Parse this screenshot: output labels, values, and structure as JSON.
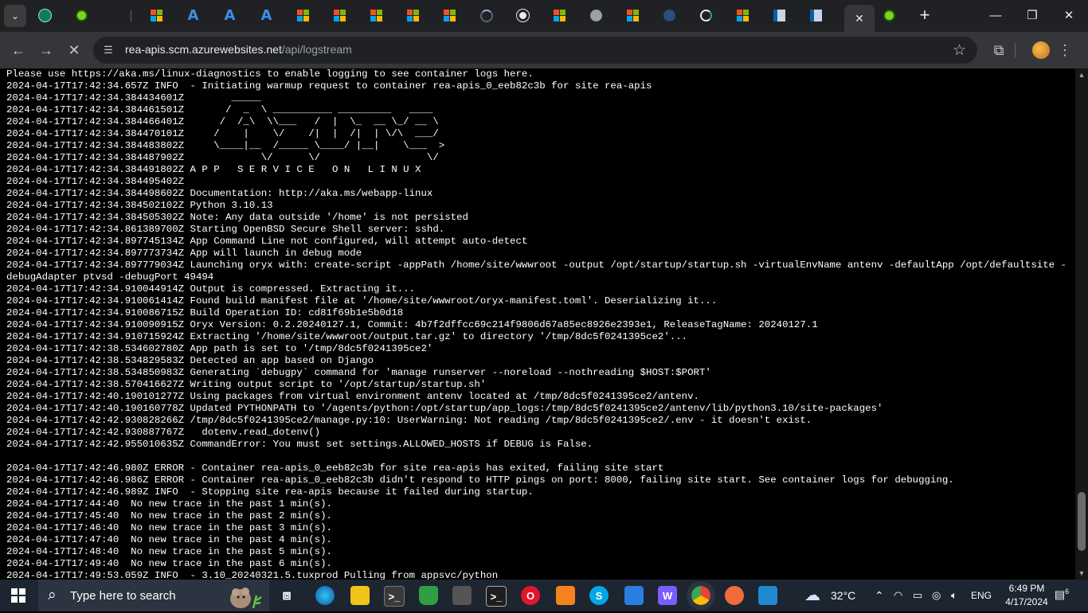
{
  "browser": {
    "tab_list_icon": "chevron-down-icon",
    "active_tab_close": "✕",
    "new_tab": "+",
    "window_controls": {
      "minimize": "—",
      "restore": "❐",
      "close": "✕"
    },
    "address": {
      "host": "rea-apis.scm.azurewebsites.net",
      "path": "/api/logstream"
    }
  },
  "log_lines": [
    "Please use https://aka.ms/linux-diagnostics to enable logging to see container logs here.",
    "2024-04-17T17:42:34.657Z INFO  - Initiating warmup request to container rea-apis_0_eeb82c3b for site rea-apis",
    "2024-04-17T17:42:34.384434601Z        _____",
    "2024-04-17T17:42:34.384461501Z       /  _  \\ __________ _________   ____",
    "2024-04-17T17:42:34.384466401Z      /  /_\\  \\\\___   /  |  \\_  __ \\_/ __ \\",
    "2024-04-17T17:42:34.384470101Z     /    |    \\/    /|  |  /|  | \\/\\  ___/",
    "2024-04-17T17:42:34.384483802Z     \\____|__  /_____ \\____/ |__|    \\___  >",
    "2024-04-17T17:42:34.384487902Z             \\/      \\/                  \\/",
    "2024-04-17T17:42:34.384491802Z A P P   S E R V I C E   O N   L I N U X",
    "2024-04-17T17:42:34.384495402Z",
    "2024-04-17T17:42:34.384498602Z Documentation: http://aka.ms/webapp-linux",
    "2024-04-17T17:42:34.384502102Z Python 3.10.13",
    "2024-04-17T17:42:34.384505302Z Note: Any data outside '/home' is not persisted",
    "2024-04-17T17:42:34.861389700Z Starting OpenBSD Secure Shell server: sshd.",
    "2024-04-17T17:42:34.897745134Z App Command Line not configured, will attempt auto-detect",
    "2024-04-17T17:42:34.897773734Z App will launch in debug mode",
    "2024-04-17T17:42:34.897779034Z Launching oryx with: create-script -appPath /home/site/wwwroot -output /opt/startup/startup.sh -virtualEnvName antenv -defaultApp /opt/defaultsite -",
    "debugAdapter ptvsd -debugPort 49494",
    "2024-04-17T17:42:34.910044914Z Output is compressed. Extracting it...",
    "2024-04-17T17:42:34.910061414Z Found build manifest file at '/home/site/wwwroot/oryx-manifest.toml'. Deserializing it...",
    "2024-04-17T17:42:34.910086715Z Build Operation ID: cd81f69b1e5b0d18",
    "2024-04-17T17:42:34.910090915Z Oryx Version: 0.2.20240127.1, Commit: 4b7f2dffcc69c214f9806d67a85ec8926e2393e1, ReleaseTagName: 20240127.1",
    "2024-04-17T17:42:34.910715924Z Extracting '/home/site/wwwroot/output.tar.gz' to directory '/tmp/8dc5f0241395ce2'...",
    "2024-04-17T17:42:38.534602780Z App path is set to '/tmp/8dc5f0241395ce2'",
    "2024-04-17T17:42:38.534829583Z Detected an app based on Django",
    "2024-04-17T17:42:38.534850983Z Generating `debugpy` command for 'manage runserver --noreload --nothreading $HOST:$PORT'",
    "2024-04-17T17:42:38.570416627Z Writing output script to '/opt/startup/startup.sh'",
    "2024-04-17T17:42:40.190101277Z Using packages from virtual environment antenv located at /tmp/8dc5f0241395ce2/antenv.",
    "2024-04-17T17:42:40.190160778Z Updated PYTHONPATH to '/agents/python:/opt/startup/app_logs:/tmp/8dc5f0241395ce2/antenv/lib/python3.10/site-packages'",
    "2024-04-17T17:42:42.930828266Z /tmp/8dc5f0241395ce2/manage.py:10: UserWarning: Not reading /tmp/8dc5f0241395ce2/.env - it doesn't exist.",
    "2024-04-17T17:42:42.930887767Z   dotenv.read_dotenv()",
    "2024-04-17T17:42:42.955010635Z CommandError: You must set settings.ALLOWED_HOSTS if DEBUG is False.",
    "",
    "2024-04-17T17:42:46.980Z ERROR - Container rea-apis_0_eeb82c3b for site rea-apis has exited, failing site start",
    "2024-04-17T17:42:46.986Z ERROR - Container rea-apis_0_eeb82c3b didn't respond to HTTP pings on port: 8000, failing site start. See container logs for debugging.",
    "2024-04-17T17:42:46.989Z INFO  - Stopping site rea-apis because it failed during startup.",
    "2024-04-17T17:44:40  No new trace in the past 1 min(s).",
    "2024-04-17T17:45:40  No new trace in the past 2 min(s).",
    "2024-04-17T17:46:40  No new trace in the past 3 min(s).",
    "2024-04-17T17:47:40  No new trace in the past 4 min(s).",
    "2024-04-17T17:48:40  No new trace in the past 5 min(s).",
    "2024-04-17T17:49:40  No new trace in the past 6 min(s).",
    "2024-04-17T17:49:53.059Z INFO  - 3.10_20240321.5.tuxprod Pulling from appsvc/python"
  ],
  "taskbar": {
    "search_placeholder": "Type here to search",
    "weather": "32°C",
    "language": "ENG",
    "time": "6:49 PM",
    "date": "4/17/2024",
    "notification_count": "6"
  }
}
